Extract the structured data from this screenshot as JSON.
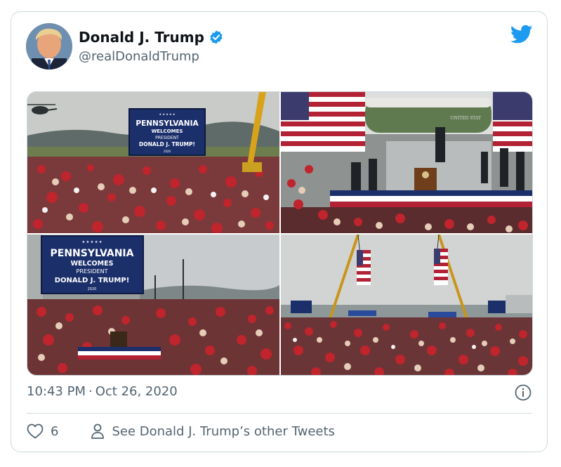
{
  "tweet": {
    "author_name": "Donald J. Trump",
    "handle": "@realDonaldTrump",
    "time": "10:43 PM",
    "separator": "·",
    "date": "Oct 26, 2020",
    "like_count": "6",
    "other_tweets_label": "See Donald J. Trump’s other Tweets"
  },
  "media": {
    "photo1_sign": [
      "PENNSYLVANIA",
      "WELCOMES",
      "PRESIDENT",
      "DONALD J. TRUMP!",
      "2020"
    ],
    "photo3_sign": [
      "PENNSYLVANIA",
      "WELCOMES",
      "PRESIDENT",
      "DONALD J. TRUMP!",
      "2020"
    ]
  },
  "icons": {
    "verified": "verified-badge-icon",
    "bird": "twitter-bird-icon",
    "info": "info-icon",
    "like": "heart-icon",
    "profile": "person-icon"
  },
  "colors": {
    "twitter_blue": "#1d9bf0",
    "border": "#cfd9de",
    "secondary_text": "#536471",
    "crowd_red": "#b3202a",
    "sign_blue": "#1b2f6b"
  }
}
